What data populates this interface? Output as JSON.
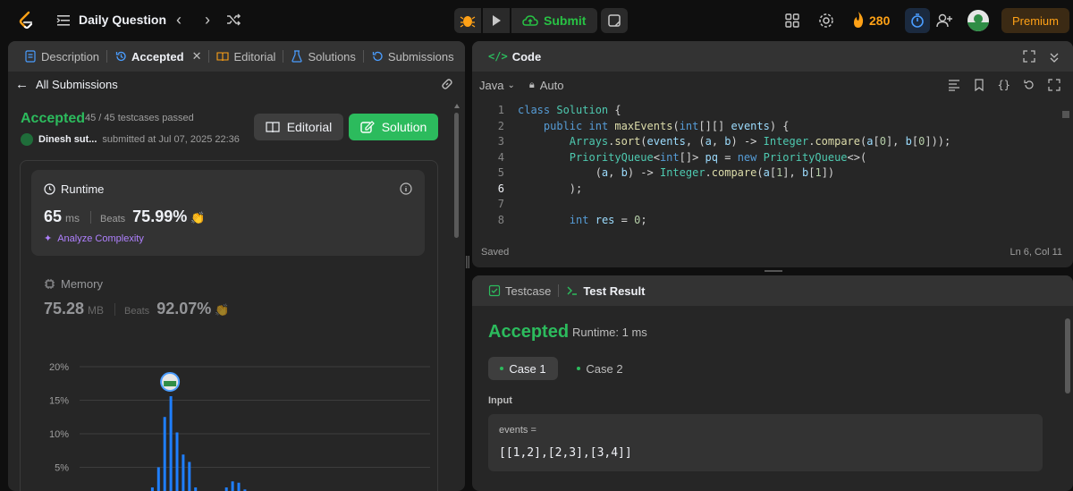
{
  "topbar": {
    "title": "Daily Question",
    "submit_label": "Submit",
    "streak": "280",
    "premium_label": "Premium"
  },
  "left_panel": {
    "tabs": [
      {
        "label": "Description"
      },
      {
        "label": "Accepted"
      },
      {
        "label": "Editorial"
      },
      {
        "label": "Solutions"
      },
      {
        "label": "Submissions"
      }
    ],
    "back_label": "All Submissions",
    "status": "Accepted",
    "testcases": "45 / 45 testcases passed",
    "user": "Dinesh sut...",
    "submitted": "submitted at Jul 07, 2025 22:36",
    "editorial_btn": "Editorial",
    "solution_btn": "Solution",
    "runtime": {
      "title": "Runtime",
      "value": "65",
      "unit": "ms",
      "beats_label": "Beats",
      "beats_value": "75.99%",
      "analyze": "Analyze Complexity"
    },
    "memory": {
      "title": "Memory",
      "value": "75.28",
      "unit": "MB",
      "beats_label": "Beats",
      "beats_value": "92.07%"
    }
  },
  "chart_data": {
    "type": "bar",
    "ytick_labels": [
      "20%",
      "15%",
      "10%",
      "5%"
    ],
    "yticks": [
      20,
      15,
      10,
      5
    ],
    "ylim": [
      0,
      20
    ],
    "grid": true,
    "values": [
      0.3,
      2.0,
      5.0,
      12.5,
      15.6,
      10.2,
      6.9,
      5.8,
      2.0,
      1.3,
      1.3,
      0.2,
      1.0,
      2.0,
      2.9,
      2.7,
      1.7
    ],
    "highlight_index": 4
  },
  "code_panel": {
    "title": "Code",
    "language": "Java",
    "mode": "Auto",
    "status": "Saved",
    "position": "Ln 6, Col 11",
    "lines": [
      {
        "n": "1",
        "html": "<span class=\"kw\">class</span> <span class=\"ty\">Solution</span> {"
      },
      {
        "n": "2",
        "html": "    <span class=\"kw\">public</span> <span class=\"kw\">int</span> <span class=\"fn\">maxEvents</span>(<span class=\"kw\">int</span>[][] <span class=\"vr\">events</span>) {"
      },
      {
        "n": "3",
        "html": "        <span class=\"ty\">Arrays</span>.<span class=\"fn\">sort</span>(<span class=\"vr\">events</span>, (<span class=\"vr\">a</span>, <span class=\"vr\">b</span>) -> <span class=\"ty\">Integer</span>.<span class=\"fn\">compare</span>(<span class=\"vr\">a</span>[<span class=\"nm\">0</span>], <span class=\"vr\">b</span>[<span class=\"nm\">0</span>]));"
      },
      {
        "n": "4",
        "html": "        <span class=\"ty\">PriorityQueue</span>&lt;<span class=\"kw\">int</span>[]&gt; <span class=\"vr\">pq</span> = <span class=\"kw\">new</span> <span class=\"ty\">PriorityQueue</span>&lt;&gt;("
      },
      {
        "n": "5",
        "html": "            (<span class=\"vr\">a</span>, <span class=\"vr\">b</span>) -> <span class=\"ty\">Integer</span>.<span class=\"fn\">compare</span>(<span class=\"vr\">a</span>[<span class=\"nm\">1</span>], <span class=\"vr\">b</span>[<span class=\"nm\">1</span>])"
      },
      {
        "n": "6",
        "html": "        );"
      },
      {
        "n": "7",
        "html": ""
      },
      {
        "n": "8",
        "html": "        <span class=\"kw\">int</span> <span class=\"vr\">res</span> = <span class=\"nm\">0</span>;"
      }
    ]
  },
  "result_panel": {
    "tab_testcase": "Testcase",
    "tab_result": "Test Result",
    "status": "Accepted",
    "runtime": "Runtime: 1 ms",
    "case1": "Case 1",
    "case2": "Case 2",
    "input_label": "Input",
    "input_name": "events =",
    "input_value": "[[1,2],[2,3],[3,4]]"
  },
  "colors": {
    "accent_green": "#2cbb5d",
    "accent_orange": "#ffa116",
    "bar_blue": "#1f7fff",
    "purple": "#b081ff"
  }
}
